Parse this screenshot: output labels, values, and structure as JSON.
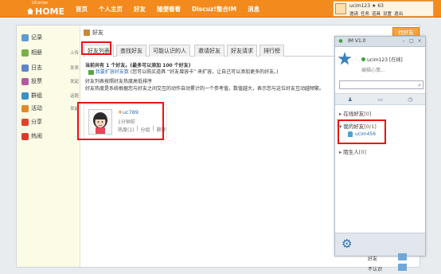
{
  "colors": {
    "brand": "#f28a1e",
    "highlight": "#ee1111",
    "link": "#2a6ab0",
    "im_blue": "#2b6fb3"
  },
  "header": {
    "logo_small": "UCenter",
    "logo_big": "HOME",
    "nav": [
      "首页",
      "个人主页",
      "好友",
      "随便看看",
      "Discuz!整合IM",
      "消息"
    ],
    "user": {
      "name": "ucim123",
      "points": "63",
      "links": [
        "邀请",
        "任务",
        "道具",
        "设置",
        "退出"
      ]
    }
  },
  "sidebar": {
    "items": [
      {
        "label": "记录",
        "extra": "",
        "icon": "chat-icon",
        "color": "#5e9bd0"
      },
      {
        "label": "相册",
        "extra": "上传",
        "icon": "album-icon",
        "color": "#7bb04a"
      },
      {
        "label": "日志",
        "extra": "发表",
        "icon": "blog-icon",
        "color": "#5f86c9"
      },
      {
        "label": "投票",
        "extra": "发起",
        "icon": "poll-icon",
        "color": "#b15b9d"
      },
      {
        "label": "群组",
        "extra": "话题",
        "icon": "group-icon",
        "color": "#3d8fc5"
      },
      {
        "label": "活动",
        "extra": "发起",
        "icon": "event-icon",
        "color": "#e0892a"
      },
      {
        "label": "分享",
        "extra": "",
        "icon": "share-icon",
        "color": "#e0432b"
      },
      {
        "label": "热闹",
        "extra": "",
        "icon": "hot-icon",
        "color": "#d93a2a"
      }
    ]
  },
  "main": {
    "breadcrumb": "好友",
    "find_button": "找好友",
    "tabs": [
      "好友列表",
      "查找好友",
      "可能认识的人",
      "邀请好友",
      "好友请求",
      "排行榜"
    ],
    "info": {
      "line1": "当前共有 1 个好友。(最多可以添加 100 个好友)",
      "line2_link": "我要扩容好友数",
      "line2_rest": "(您可以购买道具 “好友增容卡” 来扩容，让自己可以添加更多的好友。)",
      "line3": "好友列表按照好友热度高低排序",
      "line4": "好友热度是系统根据您与好友之间交互的动作自动累计的一个参考值，数值越大，表示您与这位好友互动越频繁。"
    },
    "friend": {
      "name": "uc789",
      "time": "1分钟前",
      "actions": [
        "热度(1)",
        "分组",
        "删除"
      ]
    }
  },
  "im": {
    "title": "IM V1.0",
    "username": "ucim123",
    "status": "[在线]",
    "mood": "编辑心情...",
    "search_placeholder": "",
    "groups": [
      {
        "label": "在线好友",
        "count": "[0]"
      },
      {
        "label": "我的好友",
        "count": "[0/1]"
      },
      {
        "label": "陌生人",
        "count": "[0]"
      }
    ],
    "contact": "ucim456"
  },
  "side_strip": [
    "好友",
    "不认识"
  ]
}
